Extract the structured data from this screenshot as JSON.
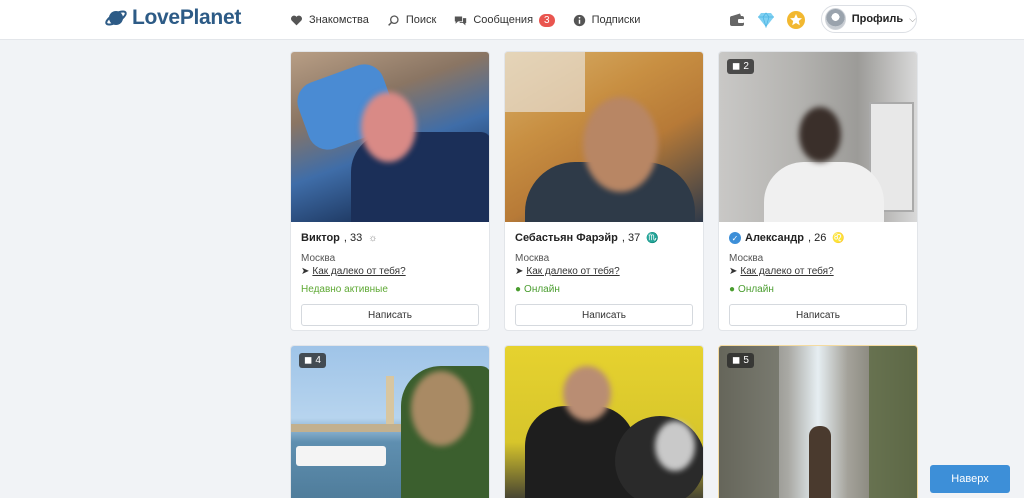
{
  "header": {
    "logo": "LovePlanet",
    "nav": [
      {
        "label": "Знакомства",
        "icon": "heart-icon"
      },
      {
        "label": "Поиск",
        "icon": "search-icon"
      },
      {
        "label": "Сообщения",
        "icon": "messages-icon",
        "badge": "3"
      },
      {
        "label": "Подписки",
        "icon": "info-icon"
      }
    ],
    "profile_label": "Профиль"
  },
  "cards": [
    {
      "name": "Виктор",
      "age": ", 33",
      "city": "Москва",
      "distance": "Как далеко от тебя?",
      "status": "Недавно активные",
      "button": "Написать"
    },
    {
      "name": "Себастьян Фарэйр",
      "age": ", 37",
      "city": "Москва",
      "distance": "Как далеко от тебя?",
      "status": "Онлайн",
      "button": "Написать"
    },
    {
      "name": "Александр",
      "age": ", 26",
      "city": "Москва",
      "distance": "Как далеко от тебя?",
      "status": "Онлайн",
      "button": "Написать",
      "photo_count": "2"
    },
    {
      "photo_count": "4"
    },
    {},
    {
      "photo_count": "5"
    }
  ],
  "up_button": "Наверх",
  "colors": {
    "accent": "#3d8fd8",
    "logo": "#2d5b86",
    "badge": "#e9554f",
    "online": "#4a9d2f"
  }
}
